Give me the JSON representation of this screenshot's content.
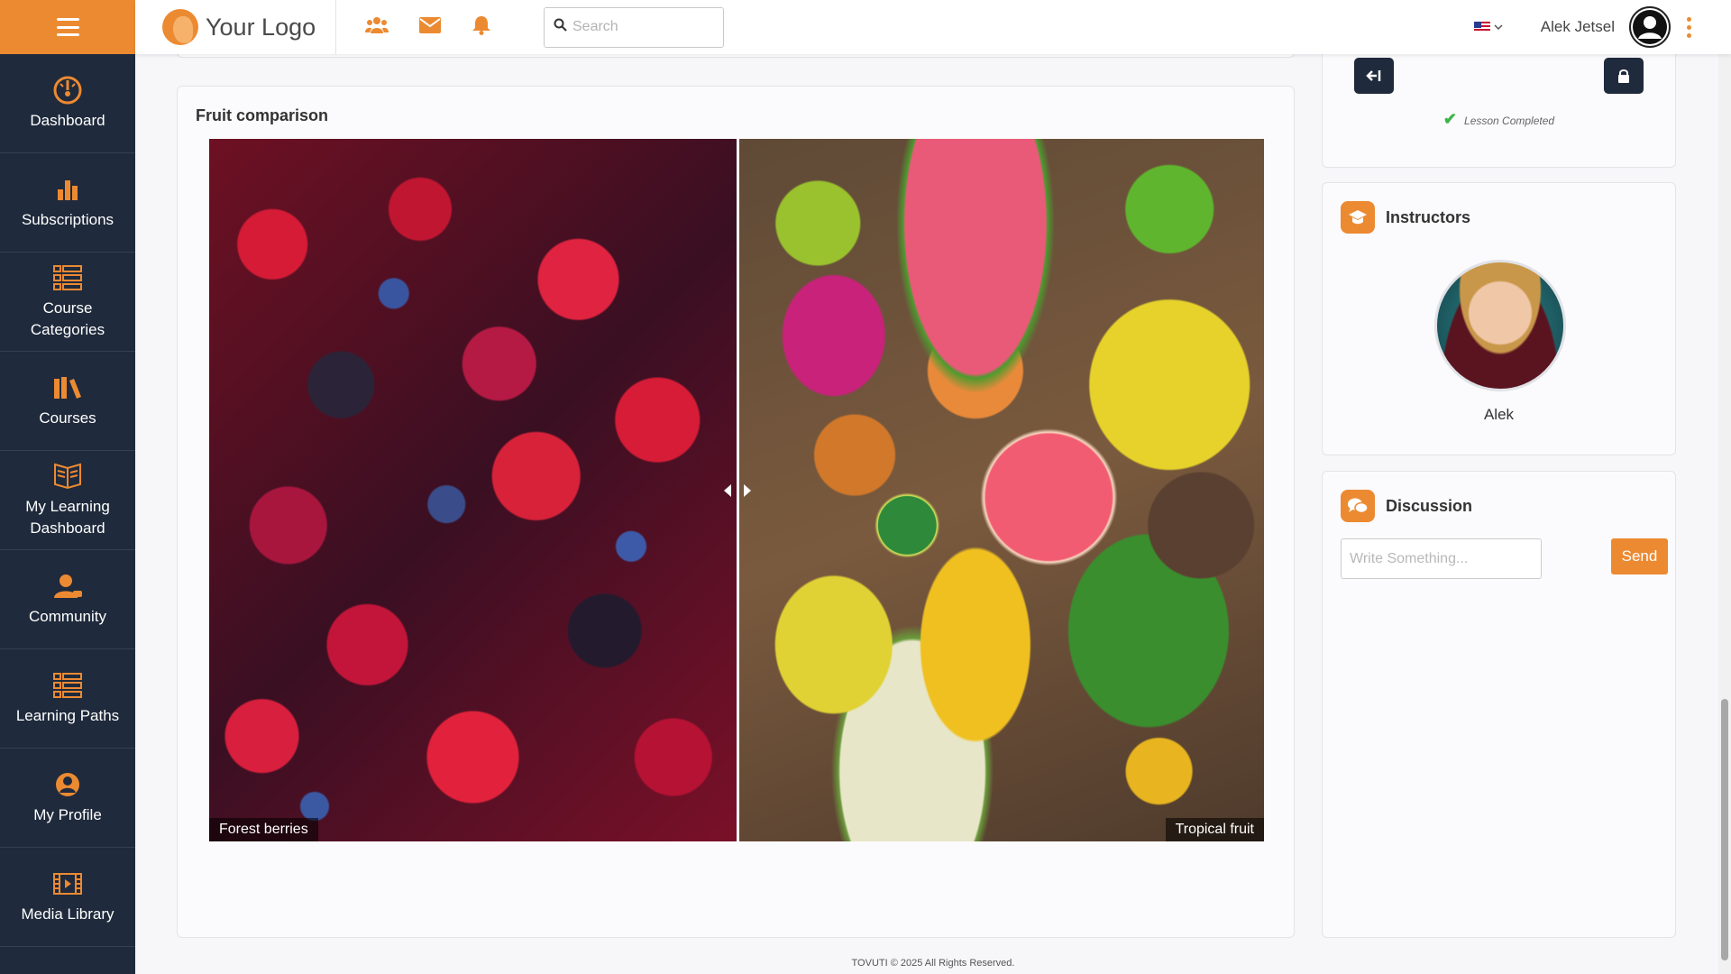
{
  "topbar": {
    "logo_text": "Your Logo",
    "search_placeholder": "Search",
    "user_name": "Alek Jetsel",
    "language": "en-US flag"
  },
  "sidebar": {
    "items": [
      {
        "label": "Dashboard",
        "icon": "dashboard-icon"
      },
      {
        "label": "Subscriptions",
        "icon": "bar-chart-icon"
      },
      {
        "label": "Course Categories",
        "icon": "list-icon"
      },
      {
        "label": "Courses",
        "icon": "books-icon"
      },
      {
        "label": "My Learning Dashboard",
        "icon": "open-book-icon"
      },
      {
        "label": "Community",
        "icon": "community-icon"
      },
      {
        "label": "Learning Paths",
        "icon": "list-icon"
      },
      {
        "label": "My Profile",
        "icon": "profile-icon"
      },
      {
        "label": "Media Library",
        "icon": "film-icon"
      }
    ]
  },
  "main": {
    "card_title": "Fruit comparison",
    "comparison": {
      "left_caption": "Forest berries",
      "right_caption": "Tropical fruit"
    }
  },
  "lesson": {
    "completed_text": "Lesson Completed"
  },
  "instructors": {
    "title": "Instructors",
    "name": "Alek"
  },
  "discussion": {
    "title": "Discussion",
    "input_placeholder": "Write Something...",
    "send_label": "Send"
  },
  "footer": {
    "text": "TOVUTI © 2025 All Rights Reserved."
  },
  "colors": {
    "accent": "#ec8a32",
    "sidebar_bg": "#1f2a3c",
    "success": "#3cb54a"
  }
}
